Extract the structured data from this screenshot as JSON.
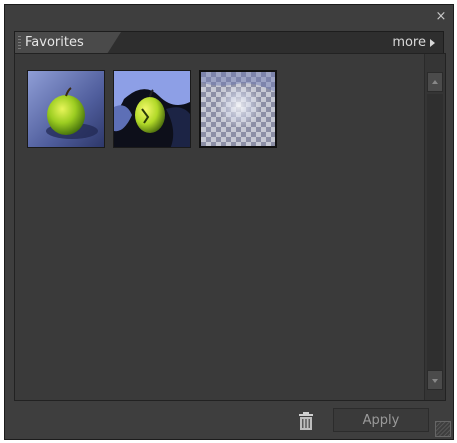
{
  "panel": {
    "close_label": "×",
    "tab": {
      "label": "Favorites"
    },
    "more": {
      "label": "more"
    }
  },
  "favorites": [
    {
      "name": "green-apple-original",
      "selected": false
    },
    {
      "name": "green-apple-cutout",
      "selected": false
    },
    {
      "name": "transparent-glow",
      "selected": true
    }
  ],
  "footer": {
    "apply_label": "Apply",
    "trash_icon": "trash-icon"
  },
  "colors": {
    "panel_bg": "#3e3e3e",
    "content_bg": "#3a3a3a",
    "text": "#e6e6e6",
    "apple_green": "#9ccd21"
  }
}
